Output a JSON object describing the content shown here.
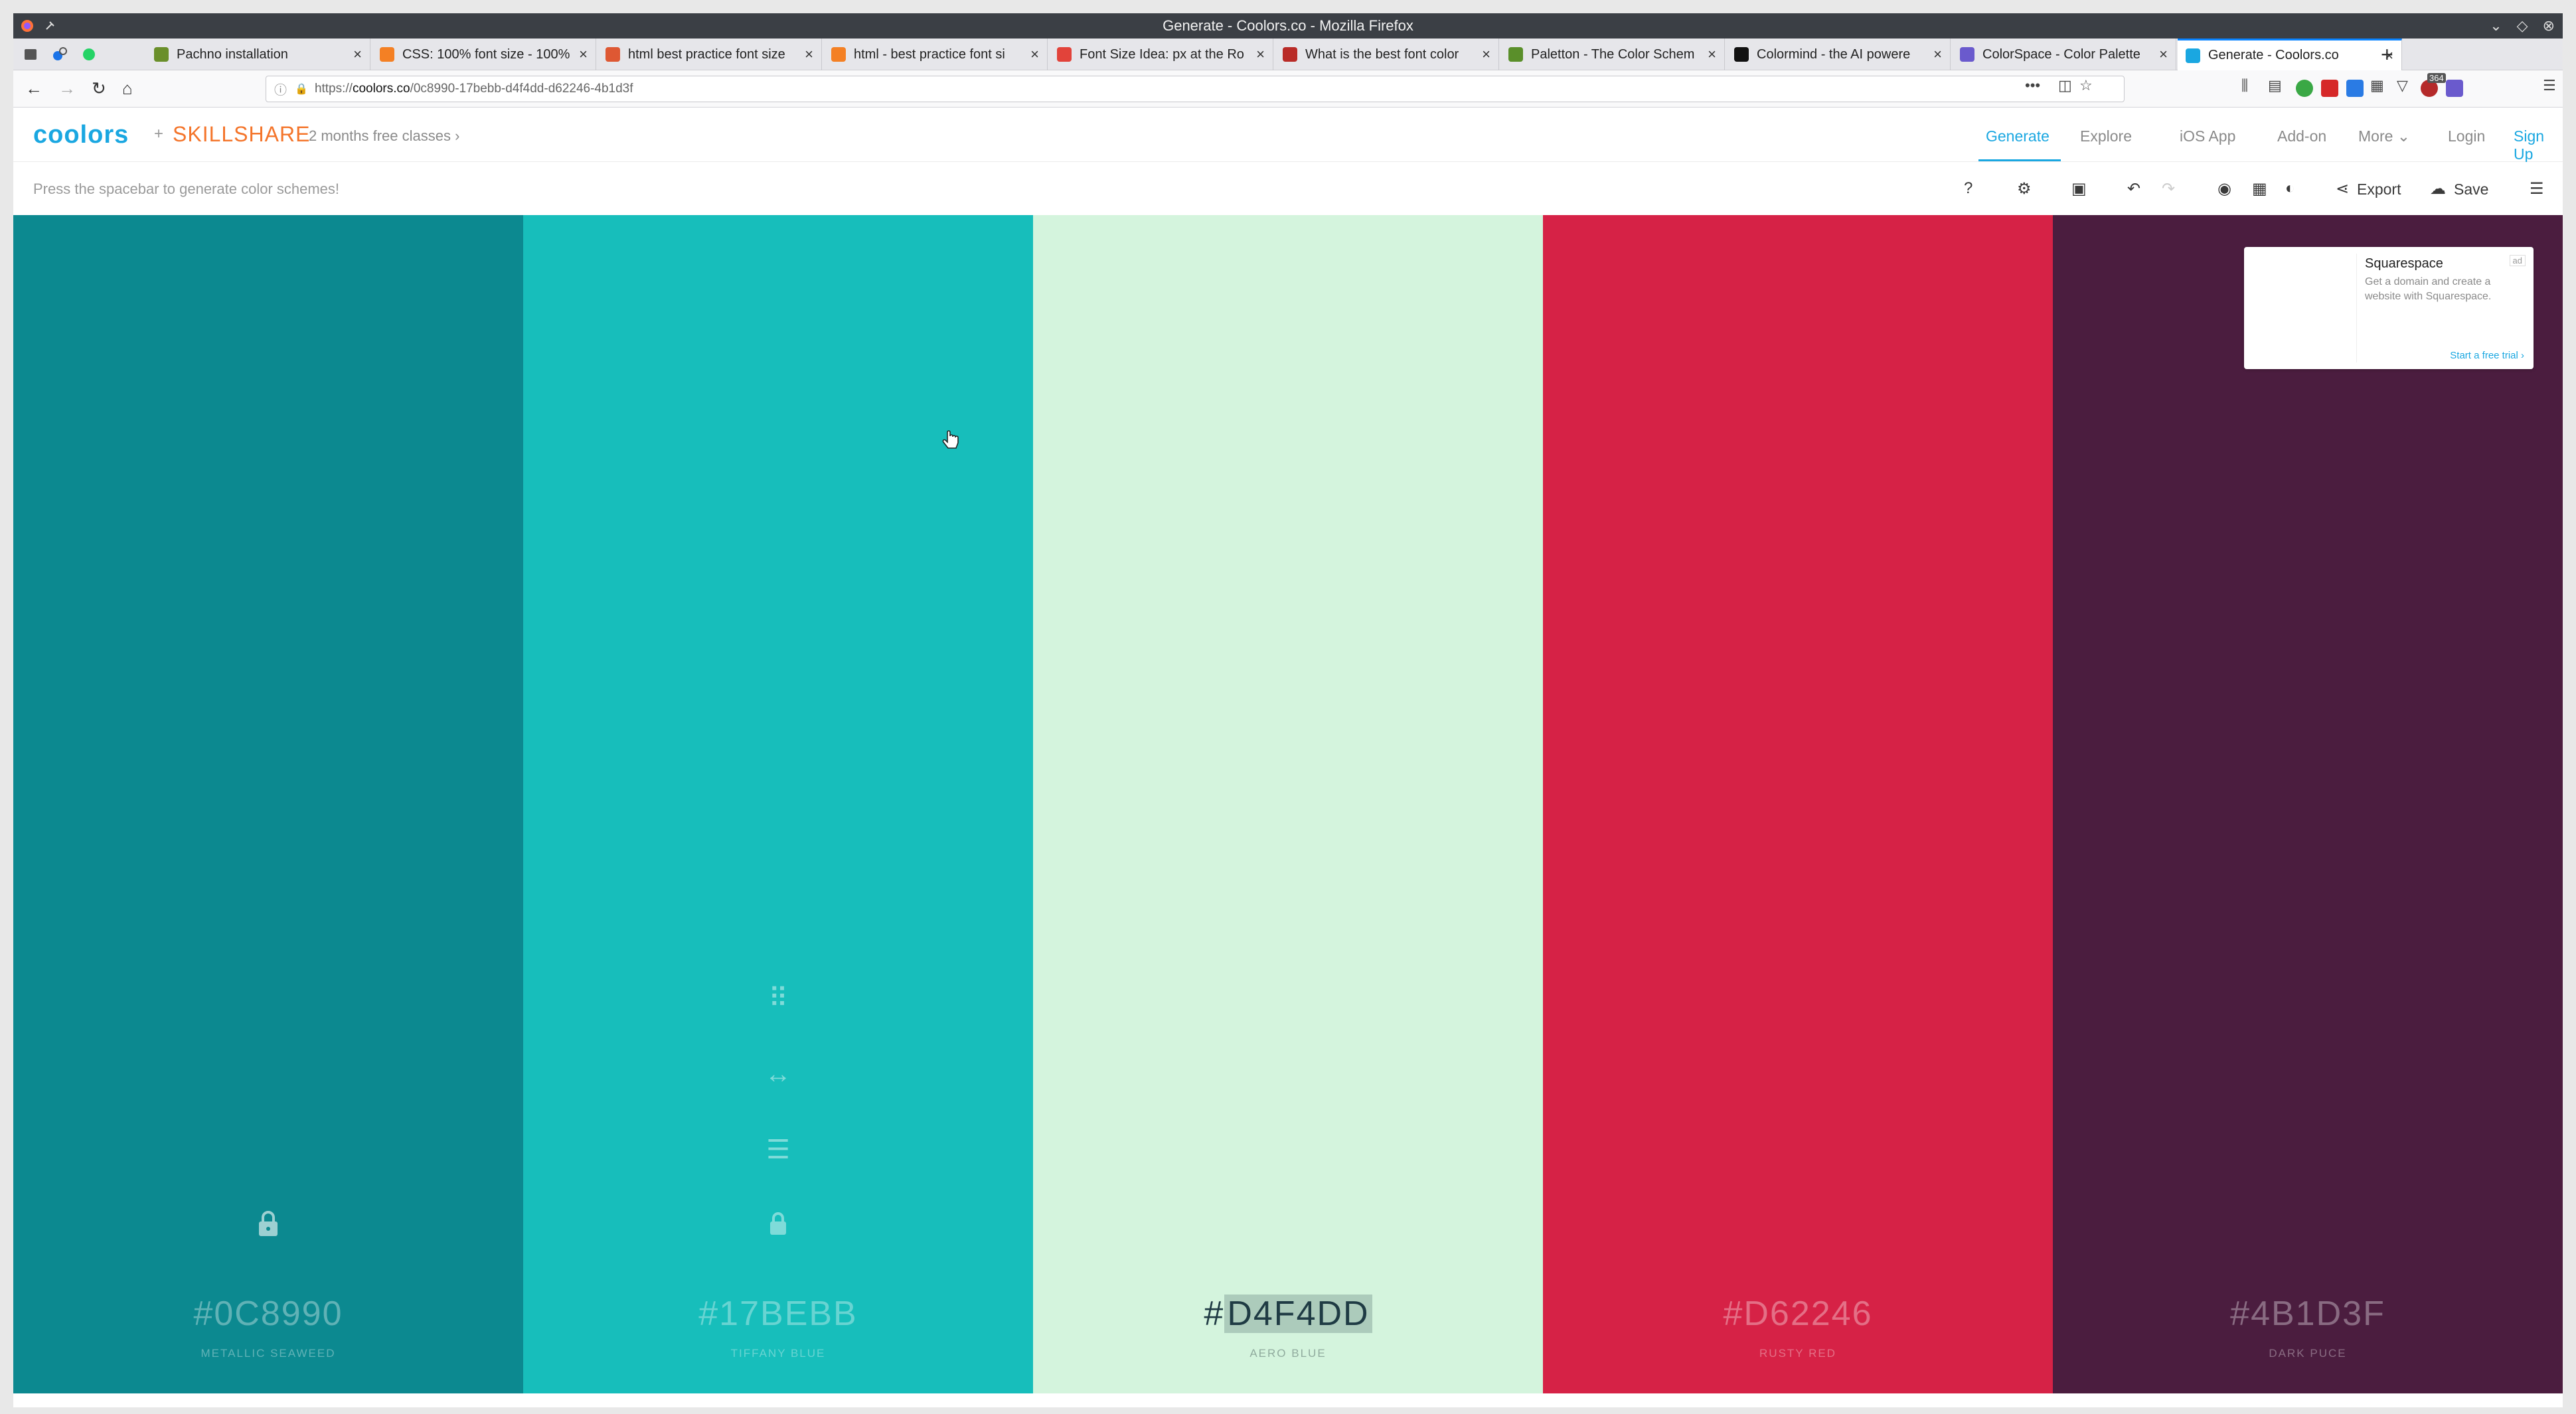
{
  "window": {
    "title": "Generate - Coolors.co - Mozilla Firefox"
  },
  "tabs": [
    {
      "label": "Pachno installation",
      "favicon_color": "#6a8f2a"
    },
    {
      "label": "CSS: 100% font size - 100%",
      "favicon_color": "#f48024"
    },
    {
      "label": "html best practice font size",
      "favicon_color": "#de5833"
    },
    {
      "label": "html - best practice font si",
      "favicon_color": "#f48024"
    },
    {
      "label": "Font Size Idea: px at the Ro",
      "favicon_color": "#e2433a"
    },
    {
      "label": "What is the best font color",
      "favicon_color": "#b92b27"
    },
    {
      "label": "Paletton - The Color Schem",
      "favicon_color": "#5a8f2a"
    },
    {
      "label": "Colormind - the AI powere",
      "favicon_color": "#111111"
    },
    {
      "label": "ColorSpace - Color Palette",
      "favicon_color": "#6a5acd"
    },
    {
      "label": "Generate - Coolors.co",
      "favicon_color": "#1aa7e1",
      "active": true
    }
  ],
  "navbar": {
    "url_prefix": "https://",
    "url_domain": "coolors.co",
    "url_path": "/0c8990-17bebb-d4f4dd-d62246-4b1d3f",
    "more_label": "•••",
    "badge_count": "364"
  },
  "header": {
    "logo": "coolors",
    "plus": "+",
    "partner": "SKILLSHARE",
    "promo": "2 months free classes",
    "promo_chevron": "›",
    "menu": {
      "generate": "Generate",
      "explore": "Explore",
      "ios_app": "iOS App",
      "addon": "Add-on",
      "more": "More",
      "login": "Login",
      "signup": "Sign Up"
    }
  },
  "toolbar": {
    "hint": "Press the spacebar to generate color schemes!",
    "export_label": "Export",
    "save_label": "Save"
  },
  "palette": [
    {
      "hex": "#0C8990",
      "name": "METALLIC SEAWEED",
      "color": "#0c8990"
    },
    {
      "hex": "#17BEBB",
      "name": "TIFFANY BLUE",
      "color": "#17bebb"
    },
    {
      "hex_prefix": "#",
      "hex_body": "D4F4DD",
      "name": "AERO BLUE",
      "color": "#d4f4dd"
    },
    {
      "hex": "#D62246",
      "name": "RUSTY RED",
      "color": "#d62246"
    },
    {
      "hex": "#4B1D3F",
      "name": "DARK PUCE",
      "color": "#4b1d3f"
    }
  ],
  "ad": {
    "title": "Squarespace",
    "badge": "ad",
    "description": "Get a domain and create a website with Squarespace.",
    "cta": "Start a free trial ›"
  },
  "colors": {
    "accent": "#1aa7e1",
    "skillshare": "#f4752b"
  }
}
